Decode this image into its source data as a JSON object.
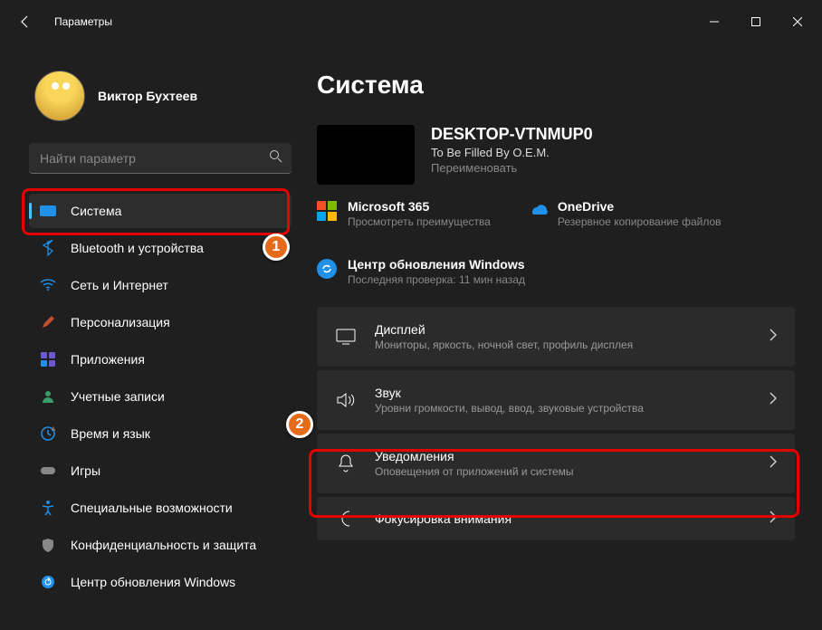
{
  "titlebar": {
    "title": "Параметры"
  },
  "user": {
    "name": "Виктор Бухтеев",
    "sub": ""
  },
  "search": {
    "placeholder": "Найти параметр"
  },
  "nav": [
    {
      "label": "Система",
      "icon": "system",
      "active": true
    },
    {
      "label": "Bluetooth и устройства",
      "icon": "bluetooth"
    },
    {
      "label": "Сеть и Интернет",
      "icon": "network"
    },
    {
      "label": "Персонализация",
      "icon": "personalization"
    },
    {
      "label": "Приложения",
      "icon": "apps"
    },
    {
      "label": "Учетные записи",
      "icon": "accounts"
    },
    {
      "label": "Время и язык",
      "icon": "time"
    },
    {
      "label": "Игры",
      "icon": "gaming"
    },
    {
      "label": "Специальные возможности",
      "icon": "accessibility"
    },
    {
      "label": "Конфиденциальность и защита",
      "icon": "privacy"
    },
    {
      "label": "Центр обновления Windows",
      "icon": "update"
    }
  ],
  "main": {
    "title": "Система",
    "pc": {
      "name": "DESKTOP-VTNMUP0",
      "model": "To Be Filled By O.E.M.",
      "rename": "Переименовать"
    },
    "services": [
      {
        "title": "Microsoft 365",
        "sub": "Просмотреть преимущества",
        "icon": "m365"
      },
      {
        "title": "OneDrive",
        "sub": "Резервное копирование файлов",
        "icon": "onedrive"
      }
    ],
    "update": {
      "title": "Центр обновления Windows",
      "sub": "Последняя проверка: 11 мин назад"
    },
    "cards": [
      {
        "title": "Дисплей",
        "sub": "Мониторы, яркость, ночной свет, профиль дисплея",
        "icon": "display"
      },
      {
        "title": "Звук",
        "sub": "Уровни громкости, вывод, ввод, звуковые устройства",
        "icon": "sound"
      },
      {
        "title": "Уведомления",
        "sub": "Оповещения от приложений и системы",
        "icon": "notifications"
      },
      {
        "title": "Фокусировка внимания",
        "sub": "",
        "icon": "focus"
      }
    ]
  },
  "annotations": {
    "1": "1",
    "2": "2"
  }
}
